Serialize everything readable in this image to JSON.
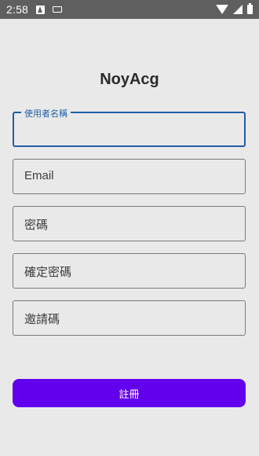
{
  "status_bar": {
    "time": "2:58",
    "icons": [
      "notification-a-icon",
      "keyboard-icon",
      "wifi-icon",
      "signal-icon",
      "battery-icon"
    ]
  },
  "app": {
    "title": "NoyAcg"
  },
  "form": {
    "username_label": "使用者名稱",
    "email_placeholder": "Email",
    "password_placeholder": "密碼",
    "confirm_password_placeholder": "確定密碼",
    "invite_code_placeholder": "邀請碼",
    "submit_label": "註冊"
  },
  "colors": {
    "background": "#e9e9e9",
    "status_bar": "#5f5f5f",
    "focus_accent": "#1f5fa6",
    "button": "#6200ee"
  }
}
